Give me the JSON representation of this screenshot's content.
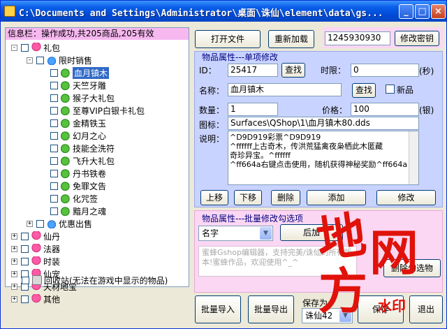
{
  "window": {
    "title": "C:\\Documents and Settings\\Administrator\\桌面\\诛仙\\element\\data\\gs...",
    "min": "_",
    "max": "□",
    "close": "×"
  },
  "info_bar": "信息栏：操作成功,共205商品,205有效",
  "tree": {
    "root": "礼包",
    "group1": "限时销售",
    "items": [
      "血月镇木",
      "天竺牙雕",
      "猴子大礼包",
      "至尊VIP白银卡礼包",
      "金精铁玉",
      "幻月之心",
      "技能全洗符",
      "飞升大礼包",
      "丹书铁卷",
      "免罪文告",
      "化咒签",
      "黯月之魂"
    ],
    "group2": "优惠出售",
    "others": [
      "仙丹",
      "法器",
      "时装",
      "仙宠",
      "天材地宝",
      "其他"
    ],
    "recycle": "回收站(无法在游戏中显示的物品)"
  },
  "top": {
    "open_file": "打开文件",
    "reload": "重新加载",
    "key_value": "1245930930",
    "change_key": "修改密钥"
  },
  "single": {
    "title": "物品属性---单项修改",
    "id_label": "ID：",
    "id_value": "25417",
    "find": "查找",
    "time_label": "时限：",
    "time_value": "0",
    "time_unit": "(秒)",
    "name_label": "名称：",
    "name_value": "血月镇木",
    "find2": "查找",
    "new_item": "新品",
    "qty_label": "数量：",
    "qty_value": "1",
    "price_label": "价格：",
    "price_value": "100",
    "price_unit": "(银)",
    "icon_label": "图标：",
    "icon_value": "Surfaces\\QShop\\1\\血月镇木80.dds",
    "desc_label": "说明：",
    "desc_lines": [
      "^D9D919彩票^D9D919",
      "^ffffff上古奇木，传洪荒猛禽夜枭栖此木匿藏",
      "奇珍异宝。^ffffff",
      "^ff664a右键点击使用，随机获得神秘奖励^ff664a"
    ],
    "up": "上移",
    "down": "下移",
    "delete": "删除",
    "add": "添加",
    "modify": "修改"
  },
  "batch": {
    "title": "物品属性---批量修改勾选项",
    "field_select": "名字",
    "btn_partial": "后加",
    "placeholder": "蜜蜂Gshop编辑器，支持完美/诛仙的所有版本!蜜蜂作品，欢迎使用^_^",
    "delete_checked": "删除勾选物",
    "import": "批量导入",
    "export": "批量导出",
    "save_as_label": "保存为",
    "save_as_value": "诛仙42",
    "save": "保存",
    "exit": "退出"
  },
  "watermark": {
    "a": "地",
    "b": "方",
    "c": "网",
    "d": "水印"
  }
}
